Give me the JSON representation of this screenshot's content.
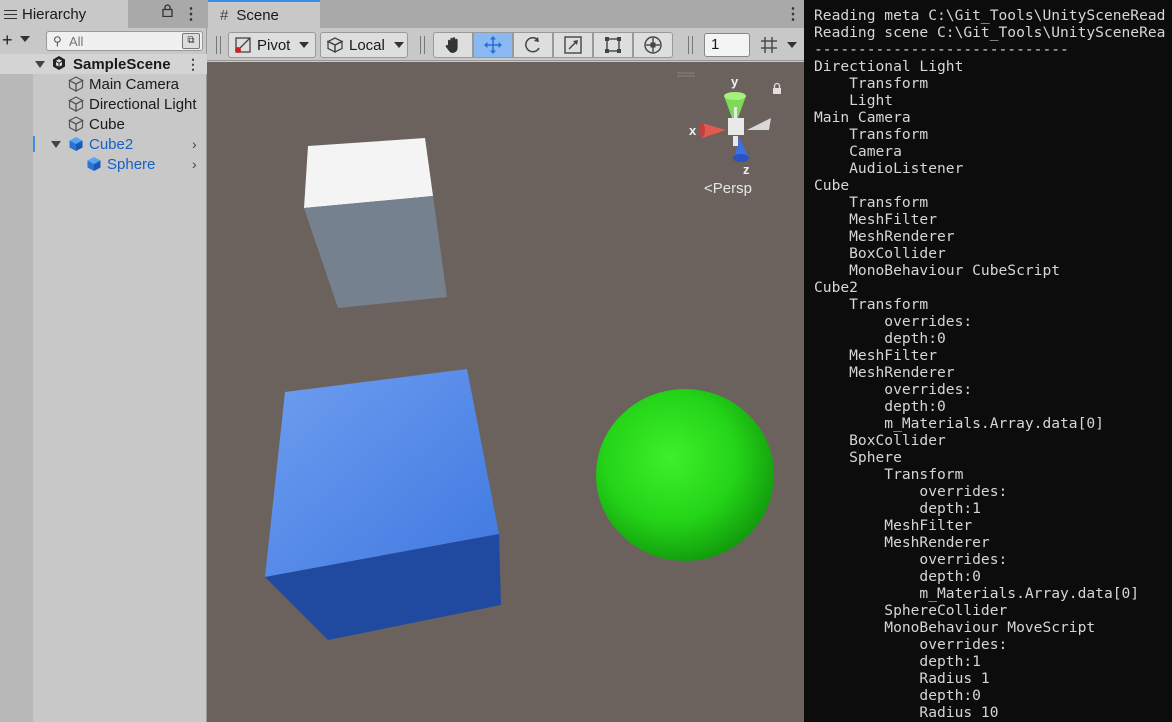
{
  "hierarchy": {
    "tab_title": "Hierarchy",
    "add_label": "+",
    "search_placeholder": "All",
    "items": [
      {
        "label": "SampleScene",
        "kind": "scene"
      },
      {
        "label": "Main Camera",
        "kind": "object"
      },
      {
        "label": "Directional Light",
        "kind": "object"
      },
      {
        "label": "Cube",
        "kind": "object"
      },
      {
        "label": "Cube2",
        "kind": "prefab"
      },
      {
        "label": "Sphere",
        "kind": "prefab"
      }
    ]
  },
  "scene": {
    "tab_title": "Scene",
    "pivot_label": "Pivot",
    "local_label": "Local",
    "snap_value": "1",
    "tools": [
      "hand-tool",
      "move-tool",
      "rotate-tool",
      "scale-tool",
      "rect-tool",
      "transform-tool"
    ],
    "active_tool": "move-tool",
    "gizmo": {
      "x_label": "x",
      "y_label": "y",
      "z_label": "z",
      "projection_label": "<Persp"
    },
    "object_colors": {
      "cube": "#f2f2f2",
      "cube2": "#4f86e6",
      "sphere": "#2ecc1f",
      "background": "#6b625e"
    }
  },
  "console": {
    "lines": [
      "Reading meta C:\\Git_Tools\\UnitySceneRead",
      "Reading scene C:\\Git_Tools\\UnitySceneRea",
      "-----------------------------",
      "Directional Light",
      "    Transform",
      "    Light",
      "Main Camera",
      "    Transform",
      "    Camera",
      "    AudioListener",
      "Cube",
      "    Transform",
      "    MeshFilter",
      "    MeshRenderer",
      "    BoxCollider",
      "    MonoBehaviour CubeScript",
      "Cube2",
      "    Transform",
      "        overrides:",
      "        depth:0",
      "    MeshFilter",
      "    MeshRenderer",
      "        overrides:",
      "        depth:0",
      "        m_Materials.Array.data[0]",
      "    BoxCollider",
      "    Sphere",
      "        Transform",
      "            overrides:",
      "            depth:1",
      "        MeshFilter",
      "        MeshRenderer",
      "            overrides:",
      "            depth:0",
      "            m_Materials.Array.data[0]",
      "        SphereCollider",
      "        MonoBehaviour MoveScript",
      "            overrides:",
      "            depth:1",
      "            Radius 1",
      "            depth:0",
      "            Radius 10"
    ]
  }
}
